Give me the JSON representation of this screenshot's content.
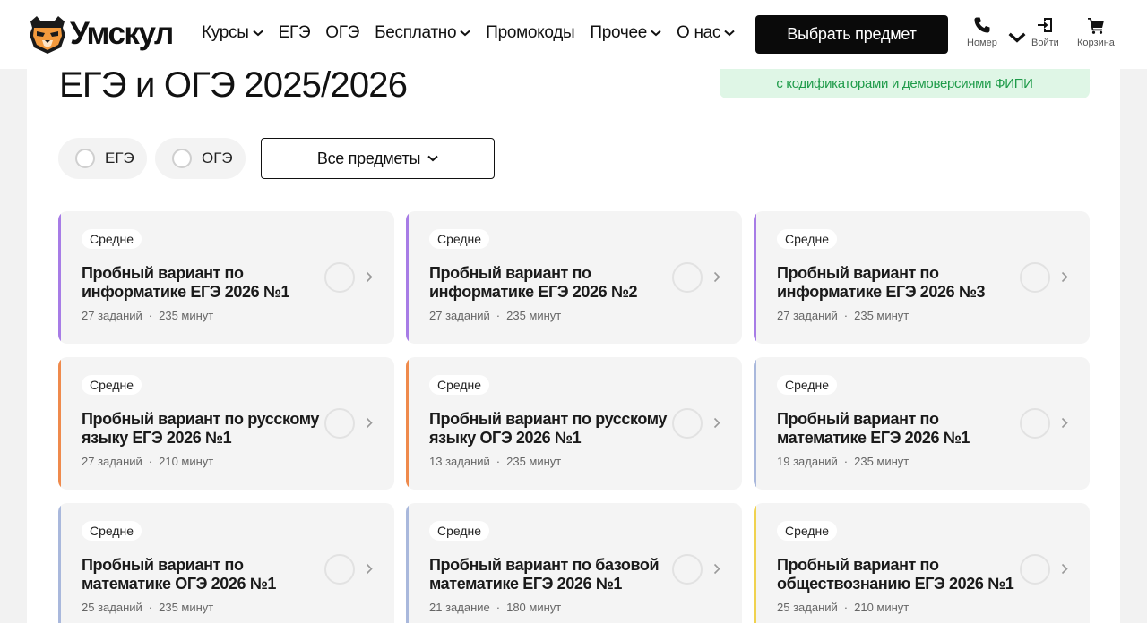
{
  "header": {
    "logo_text": "Умскул",
    "nav": [
      {
        "label": "Курсы",
        "dropdown": true
      },
      {
        "label": "ЕГЭ",
        "dropdown": false
      },
      {
        "label": "ОГЭ",
        "dropdown": false
      },
      {
        "label": "Бесплатно",
        "dropdown": true
      },
      {
        "label": "Промокоды",
        "dropdown": false
      },
      {
        "label": "Прочее",
        "dropdown": true
      },
      {
        "label": "О нас",
        "dropdown": true
      }
    ],
    "cta_label": "Выбрать предмет",
    "phone_label": "Номер",
    "login_label": "Войти",
    "cart_label": "Корзина"
  },
  "page": {
    "title": "ЕГЭ и ОГЭ 2025/2026",
    "notice": "с кодификаторами и демоверсиями ФИПИ"
  },
  "filters": {
    "ege_label": "ЕГЭ",
    "oge_label": "ОГЭ",
    "subject_select": "Все предметы"
  },
  "colors": {
    "purple": "#a77ce6",
    "orange": "#ef8a4c",
    "blue": "#a9b8dc",
    "yellow": "#f0d24f"
  },
  "cards": [
    {
      "level": "Средне",
      "title": "Пробный вариант по информатике ЕГЭ 2026 №1",
      "tasks": "27 заданий",
      "minutes": "235 минут",
      "accent": "#a77ce6"
    },
    {
      "level": "Средне",
      "title": "Пробный вариант по информатике ЕГЭ 2026 №2",
      "tasks": "27 заданий",
      "minutes": "235 минут",
      "accent": "#a77ce6"
    },
    {
      "level": "Средне",
      "title": "Пробный вариант по информатике ЕГЭ 2026 №3",
      "tasks": "27 заданий",
      "minutes": "235 минут",
      "accent": "#a77ce6"
    },
    {
      "level": "Средне",
      "title": "Пробный вариант по русскому языку ЕГЭ 2026 №1",
      "tasks": "27 заданий",
      "minutes": "210 минут",
      "accent": "#ef8a4c"
    },
    {
      "level": "Средне",
      "title": "Пробный вариант по русскому языку ОГЭ 2026 №1",
      "tasks": "13 заданий",
      "minutes": "235 минут",
      "accent": "#ef8a4c"
    },
    {
      "level": "Средне",
      "title": "Пробный вариант по математике ЕГЭ 2026 №1",
      "tasks": "19 заданий",
      "minutes": "235 минут",
      "accent": "#a9b8dc"
    },
    {
      "level": "Средне",
      "title": "Пробный вариант по математике ОГЭ 2026 №1",
      "tasks": "25 заданий",
      "minutes": "235 минут",
      "accent": "#a9b8dc"
    },
    {
      "level": "Средне",
      "title": "Пробный вариант по базовой математике ЕГЭ 2026 №1",
      "tasks": "21 задание",
      "minutes": "180 минут",
      "accent": "#a9b8dc"
    },
    {
      "level": "Средне",
      "title": "Пробный вариант по обществознанию ЕГЭ 2026 №1",
      "tasks": "25 заданий",
      "minutes": "210 минут",
      "accent": "#f0d24f"
    }
  ]
}
